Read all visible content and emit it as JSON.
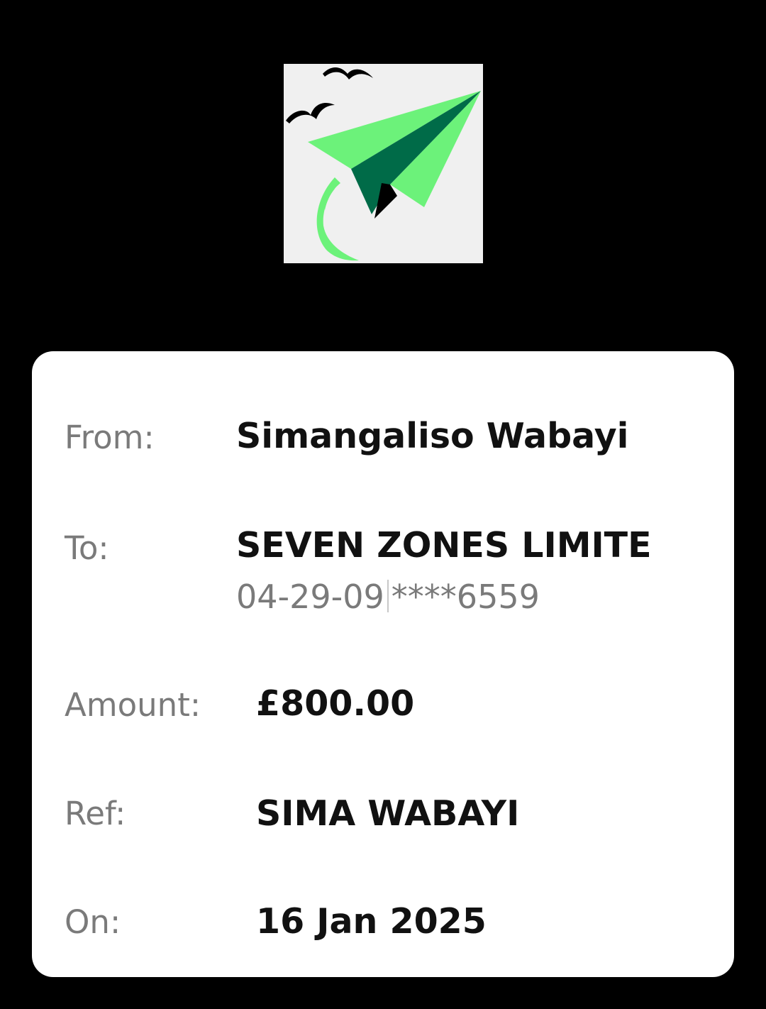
{
  "logo": {
    "icon": "paper-plane-with-birds-icon",
    "background": "#f0f0f0",
    "colors": {
      "light_green": "#6cf27a",
      "dark_green": "#006b48",
      "black": "#000000"
    }
  },
  "receipt": {
    "from_label": "From:",
    "from_value": "Simangaliso Wabayi",
    "to_label": "To:",
    "to_value": "SEVEN ZONES LIMITE",
    "sort_code": "04-29-09",
    "account_masked": "****6559",
    "amount_label": "Amount:",
    "amount_value": "£800.00",
    "ref_label": "Ref:",
    "ref_value": "SIMA WABAYI",
    "on_label": "On:",
    "on_value": "16 Jan 2025"
  }
}
